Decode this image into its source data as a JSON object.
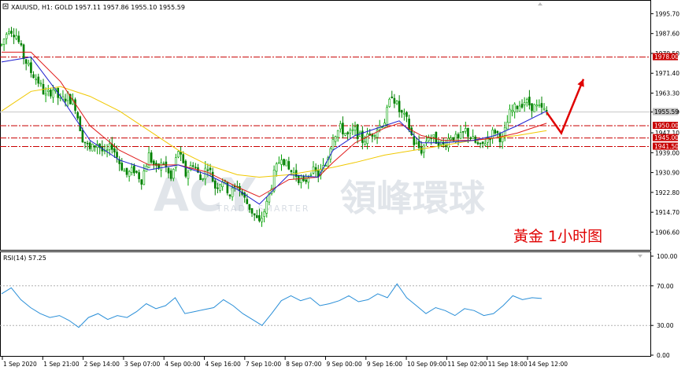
{
  "header": {
    "symbol_line": "XAUUSD, H1:  GOLD  1957.11 1957.86 1955.10 1955.59",
    "rsi_label": "RSI(14) 57.25"
  },
  "watermark": {
    "brand_en": "ACY",
    "brand_cn": "領峰環球",
    "tagline": "TRADE SMARTER"
  },
  "annotation": "黃金  1小时图",
  "colors": {
    "bull": "#00a000",
    "bear": "#008000",
    "ma_fast": "#1f1fcf",
    "ma_mid": "#e01a1a",
    "ma_slow": "#f0c800",
    "level_line": "#c80000",
    "rsi_line": "#2a8fd8",
    "arrow": "#e00000"
  },
  "chart_data": [
    {
      "type": "candlestick",
      "title": "XAUUSD, H1:  GOLD  1957.11 1957.86 1955.10 1955.59",
      "y_ticks": [
        "1995.70",
        "1987.60",
        "1979.50",
        "1971.40",
        "1963.30",
        "1955.59",
        "1947.10",
        "1939.00",
        "1930.90",
        "1922.80",
        "1914.70",
        "1906.60"
      ],
      "ylim": [
        1900.0,
        2000.0
      ],
      "x_ticks": [
        "1 Sep 2020",
        "1 Sep 21:00",
        "2 Sep 14:00",
        "3 Sep 07:00",
        "4 Sep 00:00",
        "4 Sep 16:00",
        "7 Sep 10:00",
        "8 Sep 07:00",
        "9 Sep 00:00",
        "9 Sep 16:00",
        "10 Sep 09:00",
        "11 Sep 02:00",
        "11 Sep 18:00",
        "14 Sep 12:00"
      ],
      "current_price": "1955.59",
      "levels": [
        {
          "label": "1978.00",
          "value": 1978.0
        },
        {
          "label": "1950.00",
          "value": 1950.0
        },
        {
          "label": "1945.00",
          "value": 1945.0
        },
        {
          "label": "1941.50",
          "value": 1941.5
        }
      ],
      "close_path": [
        [
          0,
          1983
        ],
        [
          3,
          1990
        ],
        [
          6,
          1987
        ],
        [
          9,
          1978
        ],
        [
          12,
          1972
        ],
        [
          15,
          1968
        ],
        [
          18,
          1962
        ],
        [
          21,
          1965
        ],
        [
          24,
          1960
        ],
        [
          27,
          1962
        ],
        [
          30,
          1958
        ],
        [
          33,
          1945
        ],
        [
          36,
          1940
        ],
        [
          39,
          1943
        ],
        [
          42,
          1938
        ],
        [
          45,
          1942
        ],
        [
          48,
          1935
        ],
        [
          51,
          1930
        ],
        [
          54,
          1932
        ],
        [
          57,
          1928
        ],
        [
          60,
          1938
        ],
        [
          63,
          1932
        ],
        [
          66,
          1935
        ],
        [
          69,
          1928
        ],
        [
          72,
          1940
        ],
        [
          75,
          1930
        ],
        [
          78,
          1935
        ],
        [
          81,
          1928
        ],
        [
          84,
          1934
        ],
        [
          87,
          1925
        ],
        [
          90,
          1928
        ],
        [
          93,
          1922
        ],
        [
          96,
          1926
        ],
        [
          99,
          1920
        ],
        [
          102,
          1915
        ],
        [
          105,
          1910
        ],
        [
          108,
          1918
        ],
        [
          111,
          1930
        ],
        [
          114,
          1938
        ],
        [
          117,
          1932
        ],
        [
          120,
          1930
        ],
        [
          123,
          1926
        ],
        [
          126,
          1932
        ],
        [
          129,
          1930
        ],
        [
          132,
          1934
        ],
        [
          135,
          1946
        ],
        [
          138,
          1949
        ],
        [
          141,
          1946
        ],
        [
          144,
          1948
        ],
        [
          147,
          1944
        ],
        [
          150,
          1946
        ],
        [
          153,
          1949
        ],
        [
          156,
          1952
        ],
        [
          159,
          1963
        ],
        [
          162,
          1956
        ],
        [
          165,
          1952
        ],
        [
          168,
          1943
        ],
        [
          171,
          1940
        ],
        [
          174,
          1946
        ],
        [
          177,
          1944
        ],
        [
          180,
          1942
        ],
        [
          183,
          1946
        ],
        [
          186,
          1944
        ],
        [
          189,
          1948
        ],
        [
          192,
          1944
        ],
        [
          195,
          1941
        ],
        [
          198,
          1945
        ],
        [
          201,
          1948
        ],
        [
          204,
          1944
        ],
        [
          207,
          1955
        ],
        [
          210,
          1958
        ],
        [
          213,
          1960
        ],
        [
          216,
          1958
        ],
        [
          219,
          1957
        ],
        [
          222,
          1955.59
        ]
      ],
      "ma_fast_path": [
        [
          0,
          1976
        ],
        [
          12,
          1978
        ],
        [
          24,
          1962
        ],
        [
          36,
          1944
        ],
        [
          48,
          1936
        ],
        [
          60,
          1932
        ],
        [
          72,
          1934
        ],
        [
          84,
          1930
        ],
        [
          96,
          1924
        ],
        [
          105,
          1918
        ],
        [
          117,
          1930
        ],
        [
          129,
          1929
        ],
        [
          135,
          1940
        ],
        [
          144,
          1946
        ],
        [
          156,
          1950
        ],
        [
          162,
          1952
        ],
        [
          171,
          1943
        ],
        [
          180,
          1943
        ],
        [
          192,
          1944
        ],
        [
          201,
          1946
        ],
        [
          210,
          1950
        ],
        [
          222,
          1956
        ]
      ],
      "ma_mid_path": [
        [
          0,
          1980
        ],
        [
          12,
          1980
        ],
        [
          24,
          1968
        ],
        [
          36,
          1950
        ],
        [
          48,
          1940
        ],
        [
          60,
          1934
        ],
        [
          72,
          1934
        ],
        [
          84,
          1931
        ],
        [
          96,
          1925
        ],
        [
          105,
          1921
        ],
        [
          117,
          1928
        ],
        [
          129,
          1929
        ],
        [
          135,
          1935
        ],
        [
          144,
          1943
        ],
        [
          156,
          1949
        ],
        [
          162,
          1951
        ],
        [
          171,
          1946
        ],
        [
          180,
          1944
        ],
        [
          192,
          1944
        ],
        [
          201,
          1945
        ],
        [
          210,
          1947
        ],
        [
          222,
          1951
        ]
      ],
      "ma_slow_path": [
        [
          0,
          1956
        ],
        [
          12,
          1964
        ],
        [
          24,
          1966
        ],
        [
          36,
          1962
        ],
        [
          48,
          1956
        ],
        [
          60,
          1948
        ],
        [
          72,
          1940
        ],
        [
          84,
          1934
        ],
        [
          96,
          1930
        ],
        [
          105,
          1929
        ],
        [
          117,
          1930
        ],
        [
          129,
          1932
        ],
        [
          135,
          1933
        ],
        [
          144,
          1935
        ],
        [
          156,
          1938
        ],
        [
          168,
          1940
        ],
        [
          180,
          1942
        ],
        [
          192,
          1944
        ],
        [
          201,
          1945
        ],
        [
          210,
          1946
        ],
        [
          222,
          1948
        ]
      ],
      "arrow_path": [
        [
          222,
          1955.5
        ],
        [
          228,
          1947
        ],
        [
          237,
          1969
        ]
      ]
    },
    {
      "type": "line",
      "title": "RSI(14) 57.25",
      "y_ticks": [
        "100.00",
        "70.00",
        "30.00",
        "0.00"
      ],
      "ylim": [
        0,
        100
      ],
      "levels": [
        70,
        30
      ],
      "series": [
        {
          "values": [
            [
              0,
              62
            ],
            [
              4,
              68
            ],
            [
              8,
              56
            ],
            [
              12,
              48
            ],
            [
              16,
              42
            ],
            [
              20,
              38
            ],
            [
              24,
              40
            ],
            [
              28,
              35
            ],
            [
              32,
              28
            ],
            [
              36,
              38
            ],
            [
              40,
              42
            ],
            [
              44,
              36
            ],
            [
              48,
              40
            ],
            [
              52,
              38
            ],
            [
              56,
              44
            ],
            [
              60,
              52
            ],
            [
              64,
              47
            ],
            [
              68,
              50
            ],
            [
              72,
              58
            ],
            [
              76,
              42
            ],
            [
              80,
              44
            ],
            [
              84,
              46
            ],
            [
              88,
              48
            ],
            [
              92,
              56
            ],
            [
              96,
              50
            ],
            [
              100,
              42
            ],
            [
              104,
              36
            ],
            [
              108,
              30
            ],
            [
              112,
              42
            ],
            [
              116,
              55
            ],
            [
              120,
              60
            ],
            [
              124,
              55
            ],
            [
              128,
              58
            ],
            [
              132,
              50
            ],
            [
              136,
              52
            ],
            [
              140,
              55
            ],
            [
              144,
              60
            ],
            [
              148,
              54
            ],
            [
              152,
              56
            ],
            [
              156,
              62
            ],
            [
              160,
              58
            ],
            [
              164,
              72
            ],
            [
              168,
              58
            ],
            [
              172,
              50
            ],
            [
              176,
              42
            ],
            [
              180,
              48
            ],
            [
              184,
              45
            ],
            [
              188,
              40
            ],
            [
              192,
              47
            ],
            [
              196,
              45
            ],
            [
              200,
              40
            ],
            [
              204,
              42
            ],
            [
              208,
              50
            ],
            [
              212,
              60
            ],
            [
              216,
              56
            ],
            [
              220,
              58
            ],
            [
              224,
              57.25
            ]
          ]
        }
      ]
    }
  ]
}
